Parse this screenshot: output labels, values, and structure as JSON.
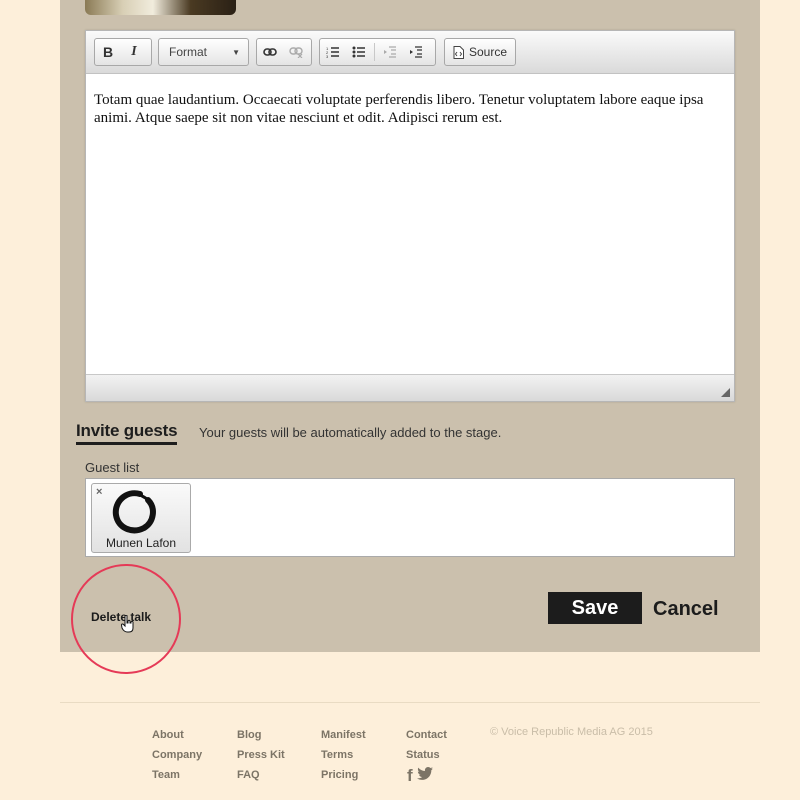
{
  "editor": {
    "toolbar": {
      "bold": "B",
      "italic": "I",
      "format_label": "Format",
      "source_label": "Source",
      "icons": [
        "bold-icon",
        "italic-icon",
        "link-icon",
        "unlink-icon",
        "numbered-list-icon",
        "bulleted-list-icon",
        "outdent-icon",
        "indent-icon",
        "source-icon"
      ]
    },
    "content": "Totam quae laudantium. Occaecati voluptate perferendis libero. Tenetur voluptatem labore eaque ipsa animi. Atque saepe sit non vitae nesciunt et odit. Adipisci rerum est."
  },
  "invite": {
    "heading": "Invite guests",
    "note": "Your guests will be automatically added to the stage."
  },
  "guests": {
    "label": "Guest list",
    "items": [
      {
        "name": "Munen Lafon",
        "remove": "×"
      }
    ]
  },
  "actions": {
    "delete": "Delete talk",
    "save": "Save",
    "cancel": "Cancel"
  },
  "footer": {
    "col1": [
      "About",
      "Company",
      "Team"
    ],
    "col2": [
      "Blog",
      "Press Kit",
      "FAQ"
    ],
    "col3": [
      "Manifest",
      "Terms",
      "Pricing"
    ],
    "col4": [
      "Contact",
      "Status"
    ],
    "copyright": "© Voice Republic Media AG 2015",
    "social": {
      "facebook": "f"
    }
  },
  "colors": {
    "panel": "#cbc0ad",
    "page_background": "#fdefda",
    "highlight": "#e53a57",
    "save_button": "#1c1c1c"
  }
}
